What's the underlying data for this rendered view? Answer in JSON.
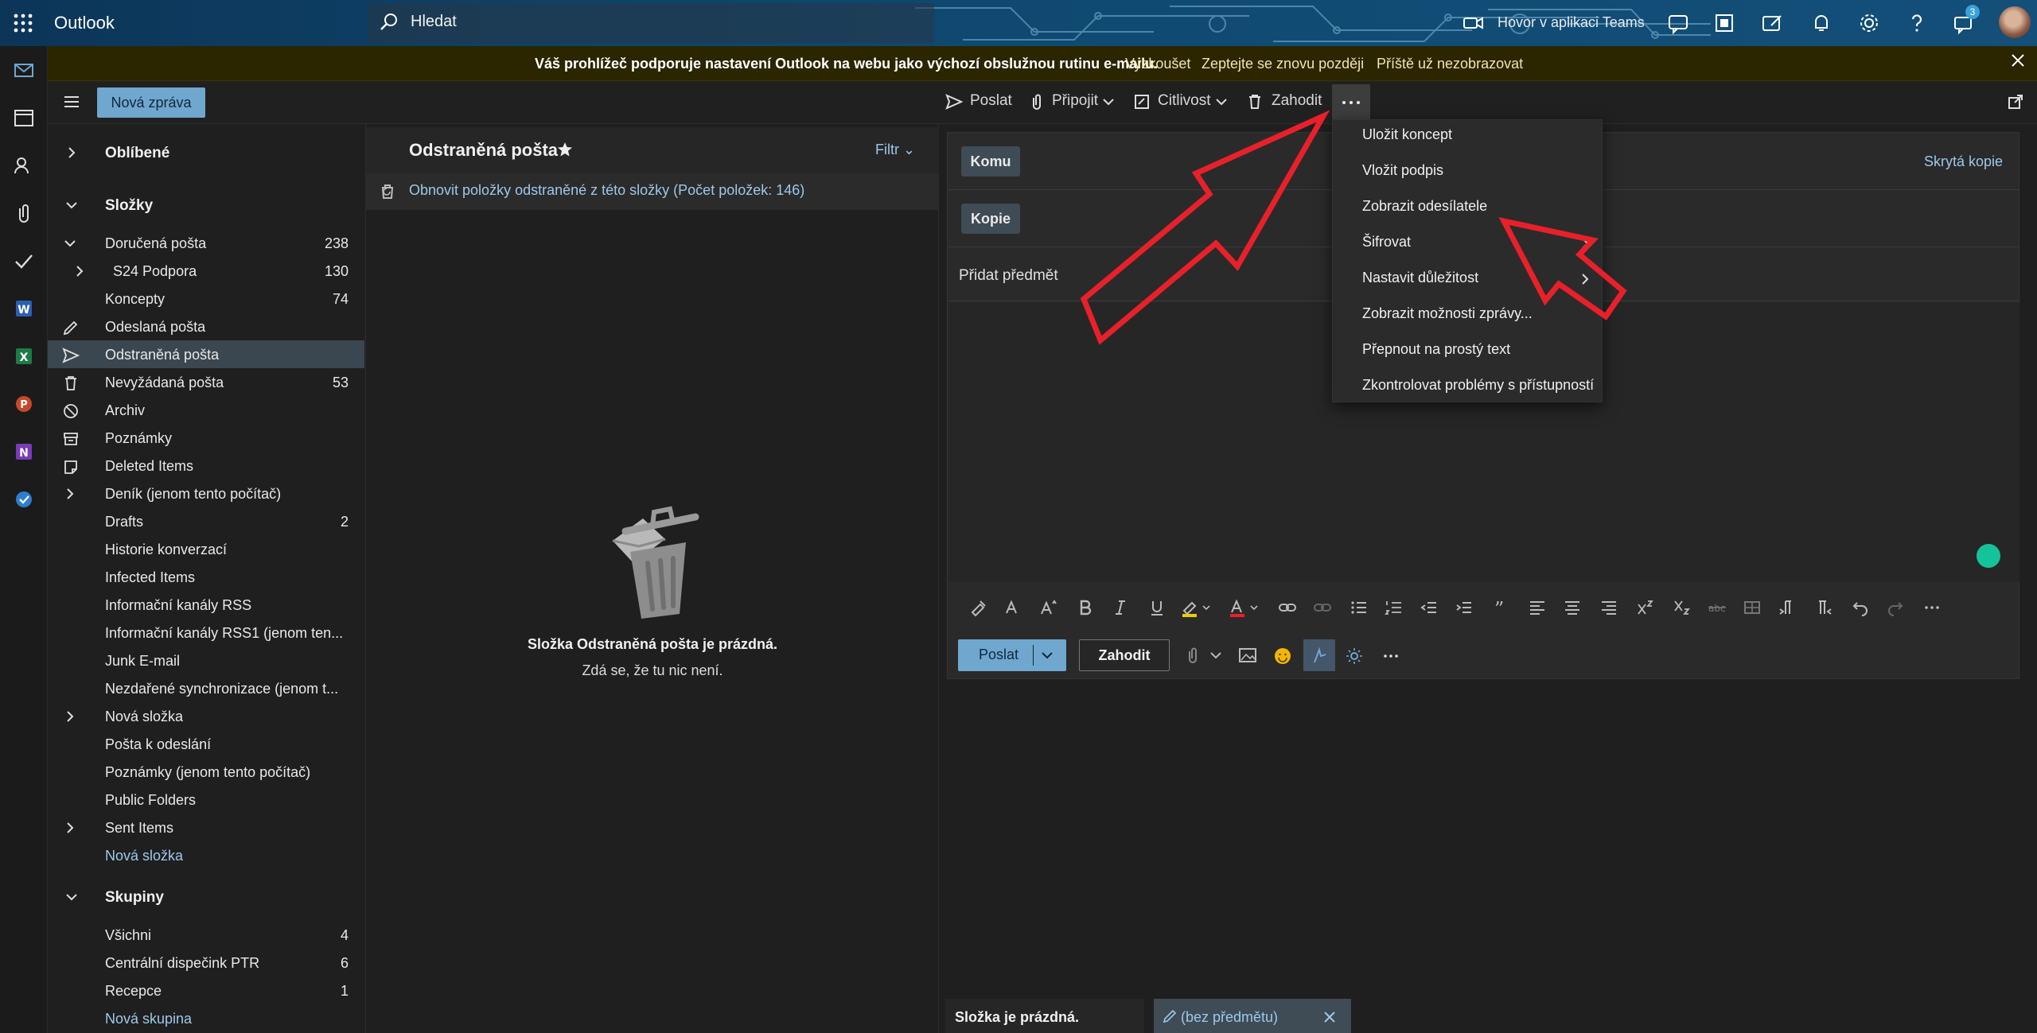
{
  "app": {
    "brand": "Outlook",
    "search_placeholder": "Hledat",
    "teams_call": "Hovor v aplikaci Teams",
    "notification_count": "3"
  },
  "banner": {
    "text": "Váš prohlížeč podporuje nastavení Outlook na webu jako výchozí obslužnou rutinu e-mailu.",
    "try": "Vyzkoušet",
    "later": "Zeptejte se znovu později",
    "never": "Příště už nezobrazovat"
  },
  "commands": {
    "new_mail": "Nová zpráva",
    "send": "Poslat",
    "attach": "Připojit",
    "sensitivity": "Citlivost",
    "discard": "Zahodit"
  },
  "folders": {
    "favorites": "Oblíbené",
    "folders_header": "Složky",
    "items": [
      {
        "label": "Doručená pošta",
        "count": "238"
      },
      {
        "label": "S24 Podpora",
        "count": "130"
      },
      {
        "label": "Koncepty",
        "count": "74"
      },
      {
        "label": "Odeslaná pošta",
        "count": ""
      },
      {
        "label": "Odstraněná pošta",
        "count": ""
      },
      {
        "label": "Nevyžádaná pošta",
        "count": "53"
      },
      {
        "label": "Archiv",
        "count": ""
      },
      {
        "label": "Poznámky",
        "count": ""
      },
      {
        "label": "Deleted Items",
        "count": ""
      },
      {
        "label": "Deník (jenom tento počítač)",
        "count": ""
      },
      {
        "label": "Drafts",
        "count": "2"
      },
      {
        "label": "Historie konverzací",
        "count": ""
      },
      {
        "label": "Infected Items",
        "count": ""
      },
      {
        "label": "Informační kanály RSS",
        "count": ""
      },
      {
        "label": "Informační kanály RSS1 (jenom ten...",
        "count": ""
      },
      {
        "label": "Junk E-mail",
        "count": ""
      },
      {
        "label": "Nezdařené synchronizace (jenom t...",
        "count": ""
      },
      {
        "label": "Nová složka",
        "count": ""
      },
      {
        "label": "Pošta k odeslání",
        "count": ""
      },
      {
        "label": "Poznámky (jenom tento počítač)",
        "count": ""
      },
      {
        "label": "Public Folders",
        "count": ""
      },
      {
        "label": "Sent Items",
        "count": ""
      },
      {
        "label": "Nová složka",
        "count": ""
      }
    ],
    "groups_header": "Skupiny",
    "groups": [
      {
        "label": "Všichni",
        "count": "4"
      },
      {
        "label": "Centrální dispečink PTR",
        "count": "6"
      },
      {
        "label": "Recepce",
        "count": "1"
      },
      {
        "label": "Nová skupina",
        "count": ""
      }
    ]
  },
  "list": {
    "title": "Odstraněná pošta",
    "filter": "Filtr",
    "restore": "Obnovit položky odstraněné z této složky (Počet položek: 146)",
    "empty_title": "Složka Odstraněná pošta je prázdná.",
    "empty_sub": "Zdá se, že tu nic není."
  },
  "compose": {
    "to": "Komu",
    "cc": "Kopie",
    "bcc": "Skrytá kopie",
    "subject_placeholder": "Přidat předmět",
    "send": "Poslat",
    "discard": "Zahodit"
  },
  "menu": {
    "items": [
      "Uložit koncept",
      "Vložit podpis",
      "Zobrazit odesílatele",
      "Šifrovat",
      "Nastavit důležitost",
      "Zobrazit možnosti zprávy...",
      "Přepnout na prostý text",
      "Zkontrolovat problémy s přístupností"
    ]
  },
  "bottom": {
    "status": "Složka je prázdná.",
    "draft": "(bez předmětu)"
  },
  "colors": {
    "accent": "#6fa7cf",
    "link": "#9cc8ea",
    "annotation": "#e8202a"
  }
}
